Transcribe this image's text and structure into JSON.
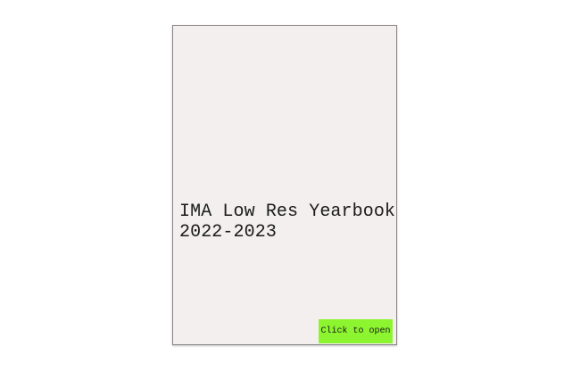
{
  "cover": {
    "title_line1": "IMA Low Res Yearbook",
    "title_line2": "2022-2023",
    "background_color": "#f2efee"
  },
  "open_button": {
    "label": "Click to open",
    "color": "#8cf52f"
  }
}
